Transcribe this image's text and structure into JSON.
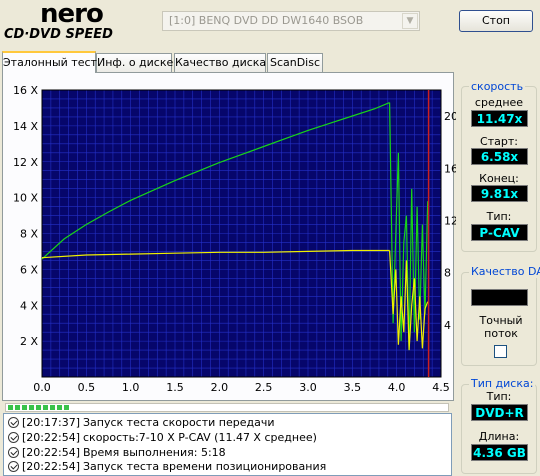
{
  "app": {
    "logo_top": "nero",
    "logo_bottom": "CD·DVD SPEED",
    "drive": "[1:0]  BENQ DVD DD DW1640 BSOB",
    "stop_label": "Стоп"
  },
  "tabs": [
    {
      "label": "Эталонный тест",
      "active": true
    },
    {
      "label": "Инф. о диске",
      "active": false
    },
    {
      "label": "Качество диска",
      "active": false
    },
    {
      "label": "ScanDisc",
      "active": false
    }
  ],
  "speed_panel": {
    "title": "скорость",
    "average_label": "среднее",
    "average_value": "11.47x",
    "start_label": "Старт:",
    "start_value": "6.58x",
    "end_label": "Конец:",
    "end_value": "9.81x",
    "type_label": "Тип:",
    "type_value": "P-CAV"
  },
  "dae_panel": {
    "title": "Качество DAE",
    "accurate_label": "Точный поток"
  },
  "disc_panel": {
    "title": "Тип диска:",
    "type_label": "Тип:",
    "type_value": "DVD+R",
    "length_label": "Длина:",
    "length_value": "4.36 GB"
  },
  "progress": {
    "segments": 9
  },
  "log": [
    {
      "time": "[20:17:37]",
      "message": "Запуск теста скорости передачи"
    },
    {
      "time": "[20:22:54]",
      "message": "скорость:7-10 X P-CAV (11.47 X среднее)"
    },
    {
      "time": "[20:22:54]",
      "message": "Время выполнения:  5:18"
    },
    {
      "time": "[20:22:54]",
      "message": "Запуск теста времени позиционирования"
    }
  ],
  "chart_data": {
    "type": "line",
    "xlim": [
      0,
      4.5
    ],
    "ylim_left": [
      0,
      16
    ],
    "ylim_right": [
      0,
      22
    ],
    "x_ticks": [
      "0.0",
      "0.5",
      "1.0",
      "1.5",
      "2.0",
      "2.5",
      "3.0",
      "3.5",
      "4.0",
      "4.5"
    ],
    "y_left_ticks": [
      "2 X",
      "4 X",
      "6 X",
      "8 X",
      "10 X",
      "12 X",
      "14 X",
      "16 X"
    ],
    "y_right_ticks": [
      "4",
      "8",
      "12",
      "16",
      "20"
    ],
    "grid": true,
    "colors": {
      "background": "#06066b",
      "grid": "#2430c8",
      "speed": "#18d418",
      "cpu": "#f0f000",
      "marker": "#cc2020"
    },
    "series": [
      {
        "color": "#18d418",
        "x": [
          0.0,
          0.25,
          0.5,
          0.75,
          1.0,
          1.25,
          1.5,
          1.75,
          2.0,
          2.25,
          2.5,
          2.75,
          3.0,
          3.25,
          3.5,
          3.75,
          3.92
        ],
        "y": [
          6.58,
          7.7,
          8.5,
          9.2,
          9.85,
          10.4,
          10.95,
          11.45,
          11.95,
          12.4,
          12.85,
          13.3,
          13.75,
          14.15,
          14.55,
          14.95,
          15.3
        ]
      },
      {
        "color": "#f0f000",
        "x": [
          0.0,
          0.5,
          1.0,
          1.5,
          2.0,
          2.5,
          3.0,
          3.5,
          3.92
        ],
        "y": [
          6.65,
          6.8,
          6.85,
          6.9,
          6.95,
          6.95,
          7.0,
          7.05,
          7.05
        ]
      },
      {
        "color": "#18d418",
        "x": [
          3.92,
          3.96,
          3.99,
          4.02,
          4.05,
          4.08,
          4.11,
          4.14,
          4.17,
          4.2,
          4.23,
          4.26,
          4.29,
          4.32,
          4.35
        ],
        "y": [
          15.3,
          3.0,
          8.0,
          12.5,
          2.0,
          7.5,
          9.0,
          1.5,
          10.5,
          2.5,
          9.5,
          3.2,
          8.5,
          3.5,
          9.8
        ]
      },
      {
        "color": "#f0f000",
        "x": [
          3.92,
          3.96,
          3.99,
          4.02,
          4.05,
          4.08,
          4.11,
          4.14,
          4.17,
          4.2,
          4.23,
          4.26,
          4.29,
          4.32,
          4.35
        ],
        "y": [
          7.05,
          3.5,
          6.0,
          1.8,
          4.5,
          2.5,
          6.5,
          1.5,
          4.0,
          5.5,
          2.0,
          4.5,
          1.6,
          3.8,
          4.2
        ]
      }
    ],
    "markers": [
      {
        "x": 4.36,
        "color": "#cc2020"
      }
    ]
  }
}
